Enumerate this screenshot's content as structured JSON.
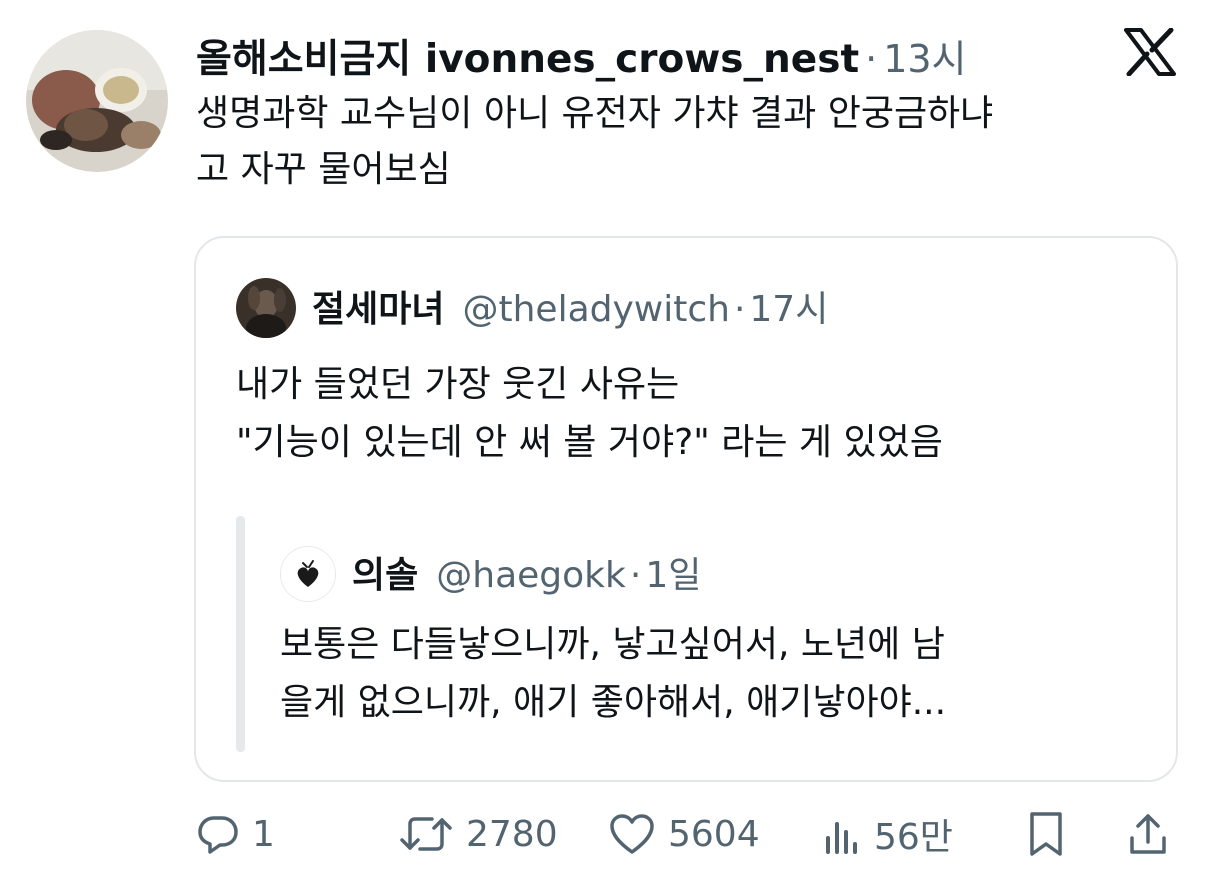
{
  "tweet": {
    "display_name": "올해소비금지 ivonnes_crows_nest",
    "separator": "·",
    "time": "13시",
    "text_line1": "생명과학 교수님이 아니 유전자 가챠 결과 안궁금하냐",
    "text_line2": "고 자꾸 물어보심"
  },
  "quote": {
    "display_name": "절세마녀",
    "handle": "@theladywitch",
    "separator": "·",
    "time": "17시",
    "text_line1": "내가 들었던 가장 웃긴 사유는",
    "text_line2": "\"기능이 있는데 안 써 볼 거야?\" 라는 게 있었음"
  },
  "nested": {
    "display_name": "의솔",
    "handle": "@haegokk",
    "separator": "·",
    "time": "1일",
    "text_line1": "보통은 다들낳으니까, 낳고싶어서, 노년에 남",
    "text_line2": "을게 없으니까, 애기 좋아해서, 애기낳아야..."
  },
  "actions": {
    "reply_count": "1",
    "retweet_count": "2780",
    "like_count": "5604",
    "view_count": "56만"
  },
  "icons": {
    "logo": "x-logo-icon",
    "reply": "reply-icon",
    "retweet": "retweet-icon",
    "like": "heart-icon",
    "views": "views-icon",
    "bookmark": "bookmark-icon",
    "share": "share-icon"
  },
  "colors": {
    "text": "#0f1419",
    "muted": "#536471",
    "border": "#e3e7ea"
  }
}
